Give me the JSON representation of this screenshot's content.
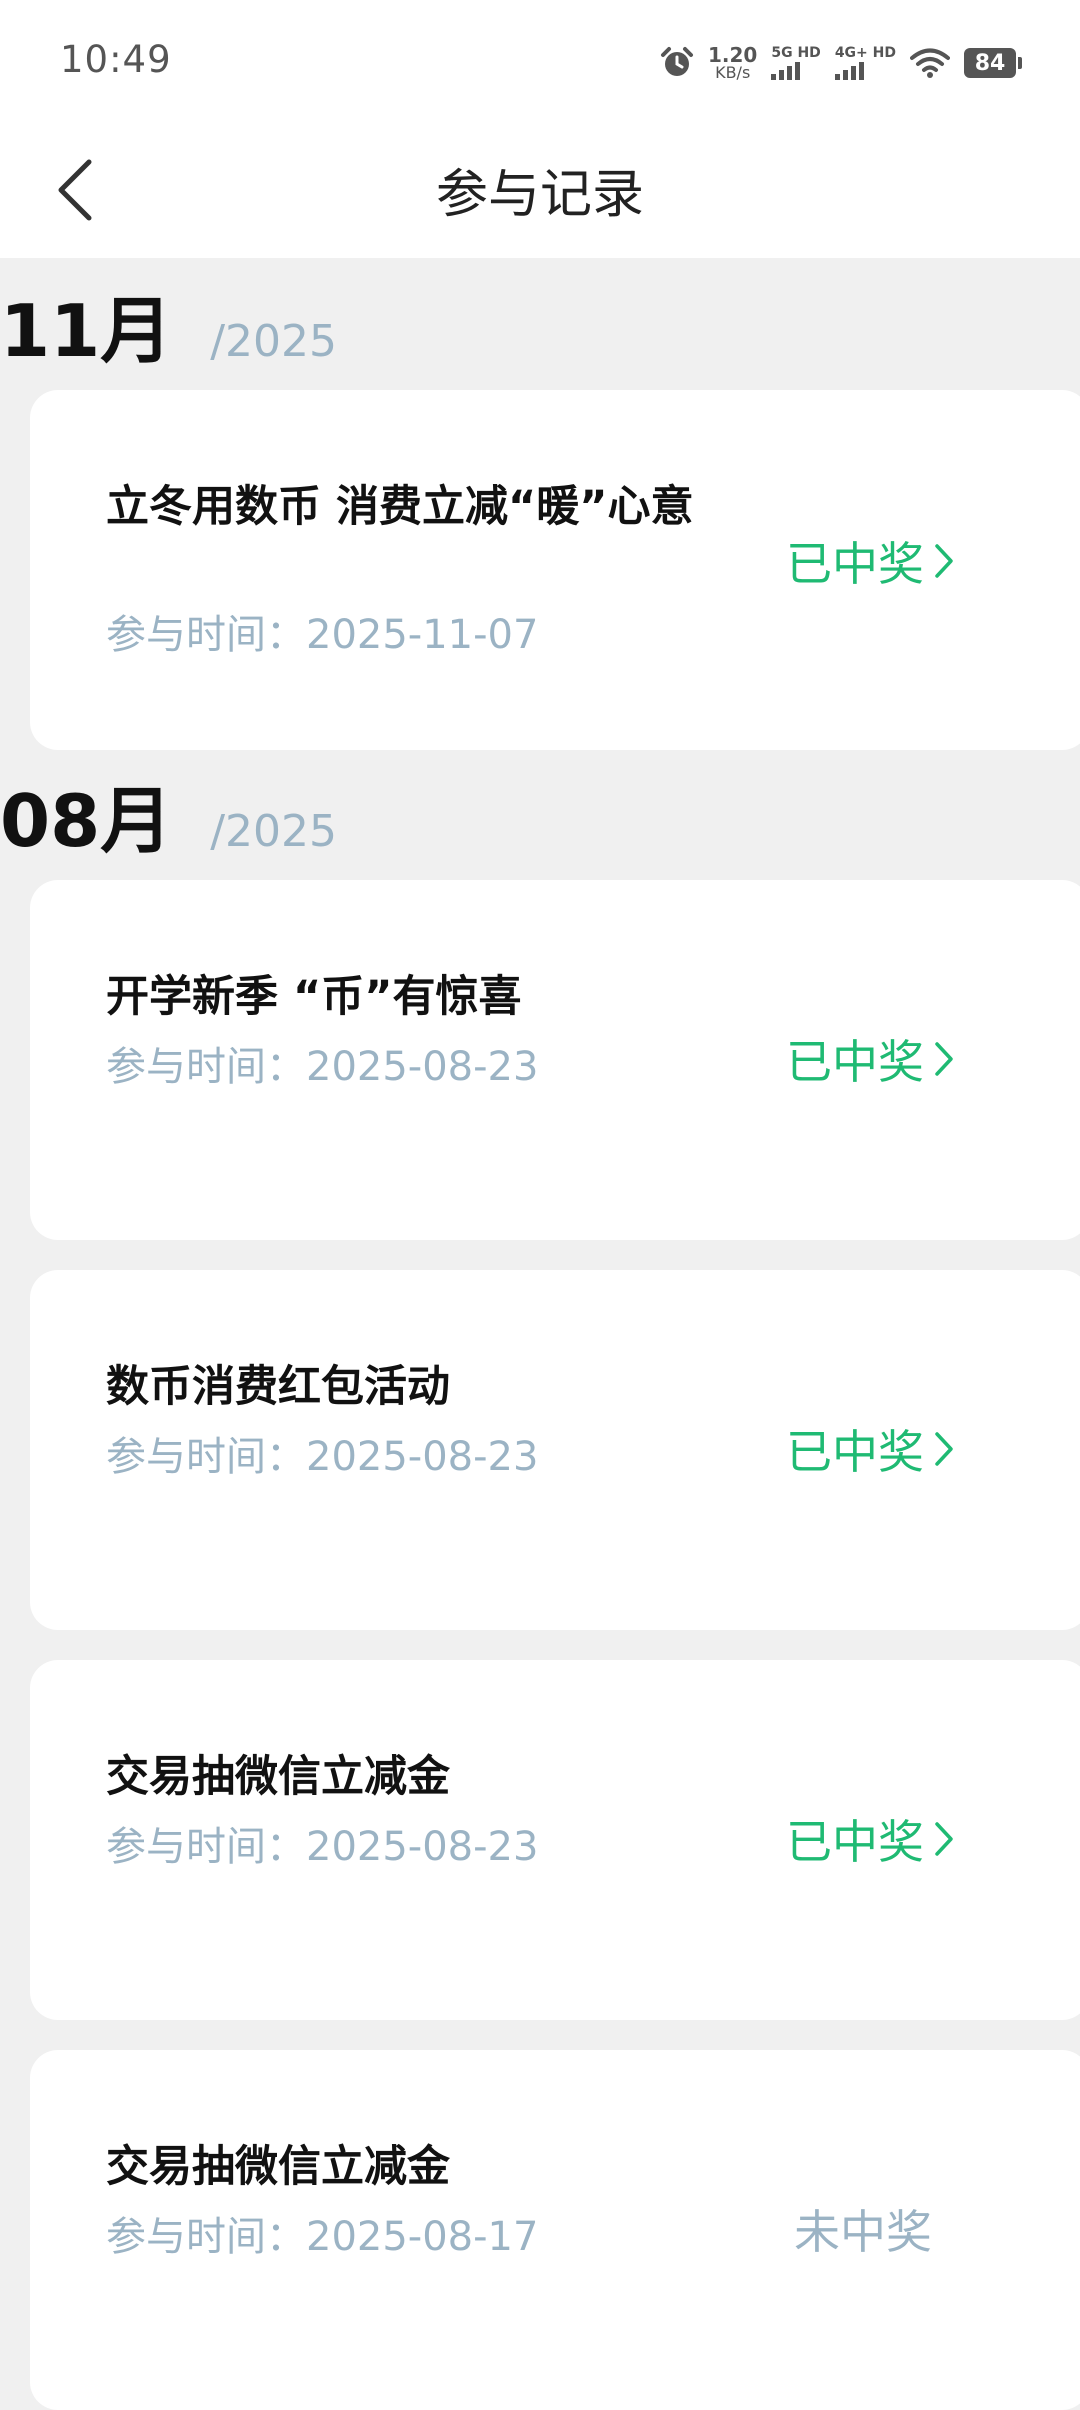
{
  "status_bar": {
    "time": "10:49",
    "net_speed_value": "1.20",
    "net_speed_unit": "KB/s",
    "sim1_label": "5G HD",
    "sim2_label": "4G+ HD",
    "battery": "84"
  },
  "header": {
    "title": "参与记录"
  },
  "groups": [
    {
      "month": "11月",
      "year": "/2025",
      "records": [
        {
          "title": "立冬用数币 消费立减“暖”心意",
          "time": "参与时间：2025-11-07",
          "status": "已中奖"
        }
      ]
    },
    {
      "month": "08月",
      "year": "/2025",
      "records": [
        {
          "title": "开学新季 “币”有惊喜",
          "time": "参与时间：2025-08-23",
          "status": "已中奖"
        },
        {
          "title": "数币消费红包活动",
          "time": "参与时间：2025-08-23",
          "status": "已中奖"
        },
        {
          "title": "交易抽微信立减金",
          "time": "参与时间：2025-08-23",
          "status": "已中奖"
        },
        {
          "title": "交易抽微信立减金",
          "time": "参与时间：2025-08-17",
          "status": "未中奖"
        }
      ]
    }
  ],
  "colors": {
    "status_won": "#1fba73",
    "status_lost": "#9bb3c4",
    "secondary_text": "#9bb3c4",
    "page_background": "#f0f0f0"
  }
}
